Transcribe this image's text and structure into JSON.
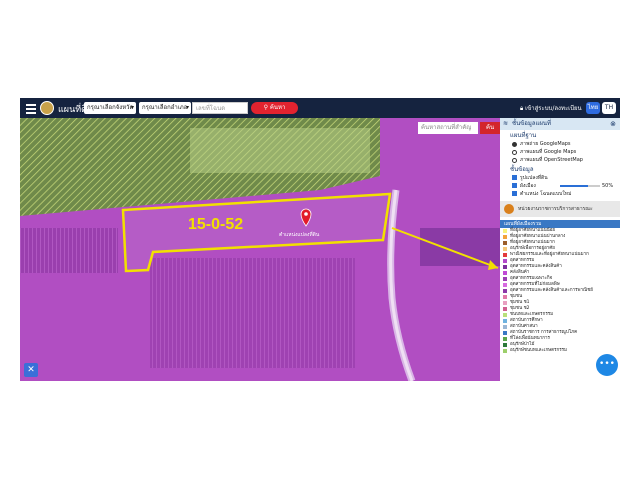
{
  "header": {
    "title": "แผนที่ดิน",
    "province_select": "กรุณาเลือกจังหวัด",
    "district_select": "กรุณาเลือกอำเภอ",
    "search_placeholder": "เลขที่โฉนด",
    "search_button": "ค้นหา",
    "user_link": "เข้าสู่ระบบ/ลงทะเบียน",
    "lang_th_en": "ไทย",
    "lang_th": "TH"
  },
  "map": {
    "search_placeholder": "ค้นหาสถานที่สำคัญ",
    "search_button": "ค้น",
    "plot_label": "15-0-52",
    "pin_label": "ตำแหน่งแปลงที่ดิน"
  },
  "panel": {
    "title": "ชั้นข้อมูลแผนที่",
    "basemap_heading": "แผนที่ฐาน",
    "basemaps": [
      {
        "label": "ภาพถ่าย GoogleMaps",
        "selected": true
      },
      {
        "label": "ภาพแผนที่ Google Maps",
        "selected": false
      },
      {
        "label": "ภาพแผนที่ OpenStreetMap",
        "selected": false
      }
    ],
    "layers_heading": "ชั้นข้อมูล",
    "layer_parcel": "รูปแปลงที่ดิน",
    "layer_zoning": "ผังเมือง",
    "zoning_opacity": "50%",
    "layer_deed": "ตำแหน่ง โฉนดแบบใหม่",
    "banner_text": "หน่วยงานราชการบริการสาธารณะ",
    "legend_heading": "แผนที่ผังเมืองรวม",
    "legend": [
      {
        "label": "ที่อยู่อาศัยหนาแน่นน้อย",
        "color": "#f7f27a"
      },
      {
        "label": "ที่อยู่อาศัยหนาแน่นปานกลาง",
        "color": "#f2a23a"
      },
      {
        "label": "ที่อยู่อาศัยหนาแน่นมาก",
        "color": "#9b5e2a"
      },
      {
        "label": "อนุรักษ์เพื่อการอยู่อาศัย",
        "color": "#f5c97a"
      },
      {
        "label": "พาณิชยกรรมและที่อยู่อาศัยหนาแน่นมาก",
        "color": "#e23b3b"
      },
      {
        "label": "อุตสาหกรรม",
        "color": "#b249c9"
      },
      {
        "label": "อุตสาหกรรมและคลังสินค้า",
        "color": "#7d2f9c"
      },
      {
        "label": "คลังสินค้า",
        "color": "#c04ad6"
      },
      {
        "label": "อุตสาหกรรมเฉพาะกิจ",
        "color": "#9c3fb5"
      },
      {
        "label": "อุตสาหกรรมที่ไม่ก่อมลพิษ",
        "color": "#d66ae0"
      },
      {
        "label": "อุตสาหกรรมและคลังสินค้าและการพาณิชย์",
        "color": "#8d3aa8"
      },
      {
        "label": "ชุมชน",
        "color": "#e07aa8"
      },
      {
        "label": "ชุมชน ช1",
        "color": "#e8a0c0"
      },
      {
        "label": "ชุมชน ช2",
        "color": "#d06090"
      },
      {
        "label": "ชนบทและเกษตรกรรม",
        "color": "#b8e07a"
      },
      {
        "label": "สถาบันการศึกษา",
        "color": "#6fb3e0"
      },
      {
        "label": "สถาบันศาสนา",
        "color": "#9bb7d4"
      },
      {
        "label": "สถาบันราชการ การสาธารณูปโภค",
        "color": "#3a78c4"
      },
      {
        "label": "ที่โล่งเพื่อนันทนาการ",
        "color": "#5ca64c"
      },
      {
        "label": "อนุรักษ์ป่าไม้",
        "color": "#2d7a3a"
      },
      {
        "label": "อนุรักษ์ชนบทและเกษตรกรรม",
        "color": "#9ccf6a"
      }
    ]
  }
}
